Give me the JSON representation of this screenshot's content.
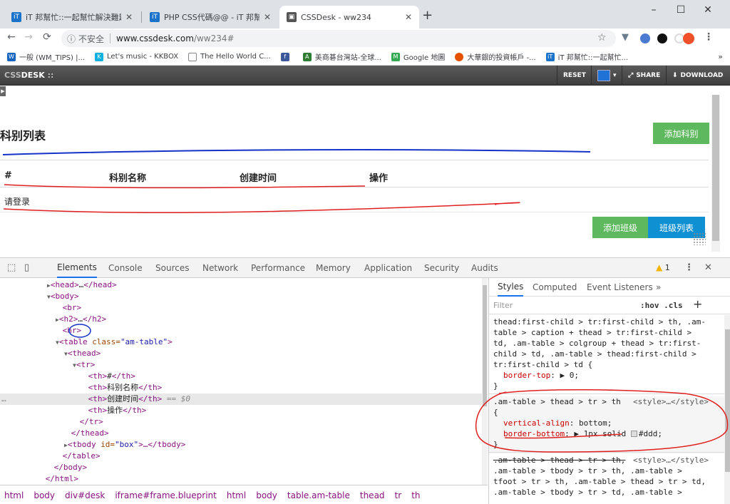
{
  "browser": {
    "tabs": [
      {
        "title": "iT 邦幫忙::一起幫忙解決難題，拯",
        "favicon_color": "#1a73c8"
      },
      {
        "title": "PHP CSS代碼@@ - iT 邦幫忙::一",
        "favicon_color": "#1a73c8"
      },
      {
        "title": "CSSDesk - ww234",
        "favicon_color": "#555555"
      }
    ],
    "new_tab": "+",
    "window": {
      "minimize": "–",
      "maximize": "☐",
      "close": "✕"
    },
    "address": {
      "security": "不安全",
      "host": "www.cssdesk.com",
      "path": "/ww234#"
    },
    "bookmarks": [
      {
        "label": "一般 (WM_TIPS) |...",
        "color": "#1565c0"
      },
      {
        "label": "Let's music - KKBOX",
        "color": "#0ab0e0"
      },
      {
        "label": "The Hello World C...",
        "color": "#888888"
      },
      {
        "label": "",
        "color": "#3b5998"
      },
      {
        "label": "美商碁台灣站-全球...",
        "color": "#2e7d32"
      },
      {
        "label": "Google 地圖",
        "color": "#34a853"
      },
      {
        "label": "大華銀的投資帳戶 -...",
        "color": "#e65100"
      },
      {
        "label": "iT 邦幫忙::一起幫忙...",
        "color": "#1a73c8"
      }
    ],
    "bookmarks_more": "»"
  },
  "cssdesk": {
    "logo_prefix": "CSS",
    "logo_bold": "DESK",
    "logo_suffix": " ::",
    "reset": "RESET",
    "share": "SHARE",
    "download": "DOWNLOAD",
    "blueprint_color": "#1f73d6"
  },
  "preview": {
    "title": "科别列表",
    "add_subject": "添加科别",
    "headers": [
      "#",
      "科别名称",
      "创建时间",
      "操作"
    ],
    "row_text": "请登录",
    "add_class": "添加班级",
    "class_list": "班级列表"
  },
  "devtools": {
    "tabs": [
      "Elements",
      "Console",
      "Sources",
      "Network",
      "Performance",
      "Memory",
      "Application",
      "Security",
      "Audits"
    ],
    "warnings": "1",
    "dom": [
      {
        "indent": 0,
        "open": "<head>",
        "mid": "…",
        "close": "</head>",
        "arrow": "▶"
      },
      {
        "indent": 0,
        "open": "<body>",
        "arrow": "▼"
      },
      {
        "indent": 1,
        "open": "<br>"
      },
      {
        "indent": 1,
        "open": "<h2>",
        "mid": "…",
        "close": "</h2>",
        "arrow": "▶"
      },
      {
        "indent": 1,
        "open": "<hr>"
      },
      {
        "indent": 1,
        "open": "<table ",
        "attr": "class=",
        "val": "\"am-table\"",
        "close": ">",
        "arrow": "▼"
      },
      {
        "indent": 2,
        "open": "<thead>",
        "arrow": "▼"
      },
      {
        "indent": 3,
        "open": "<tr>",
        "arrow": "▼"
      },
      {
        "indent": 4,
        "open": "<th>",
        "mid": "#",
        "close": "</th>"
      },
      {
        "indent": 4,
        "open": "<th>",
        "mid": "科别名称",
        "close": "</th>"
      },
      {
        "indent": 4,
        "open": "<th>",
        "mid": "创建时间",
        "close": "</th>",
        "extra": " == $0",
        "selected": true
      },
      {
        "indent": 4,
        "open": "<th>",
        "mid": "操作",
        "close": "</th>"
      },
      {
        "indent": 3,
        "open": "</tr>"
      },
      {
        "indent": 2,
        "open": "</thead>"
      },
      {
        "indent": 2,
        "open": "<tbody ",
        "attr": "id=",
        "val": "\"box\"",
        "close": ">…</tbody>",
        "arrow": "▶"
      },
      {
        "indent": 1,
        "open": "</table>"
      },
      {
        "indent": 0,
        "open": "</body>"
      },
      {
        "indent": -1,
        "open": "</html>"
      }
    ],
    "breadcrumbs": [
      "html",
      "body",
      "div#desk",
      "iframe#frame.blueprint",
      "html",
      "body",
      "table.am-table",
      "thead",
      "tr",
      "th"
    ],
    "styles": {
      "tabs": [
        "Styles",
        "Computed",
        "Event Listeners",
        "»"
      ],
      "filter_placeholder": "Filter",
      "hov_cls": ":hov  .cls",
      "plus": "+",
      "rule1": [
        "thead:first-child > tr:first-child > th, .am-",
        "table > caption + thead > tr:first-child >",
        "td, .am-table > colgroup + thead > tr:first-",
        "child > td, .am-table > thead:first-child >",
        "tr:first-child > td {"
      ],
      "rule1_prop": "border-top",
      "rule1_val": "0;",
      "rule2_selector": ".am-table > thead > tr > th",
      "rule2_source": "<style>…</style>",
      "rule2_decls": [
        {
          "prop": "vertical-align",
          "val": "bottom;"
        },
        {
          "prop": "border-bottom",
          "val": "1px solid #ddd;"
        }
      ],
      "rule3_selector": ".am-table > thead > tr > th,",
      "rule3_source": "<style>…</style>",
      "rule3_lines": [
        ".am-table > tbody > tr > th, .am-table >",
        "tfoot > tr > th, .am-table > thead > tr > td,",
        ".am-table > tbody > tr > td, .am-table >"
      ]
    }
  }
}
